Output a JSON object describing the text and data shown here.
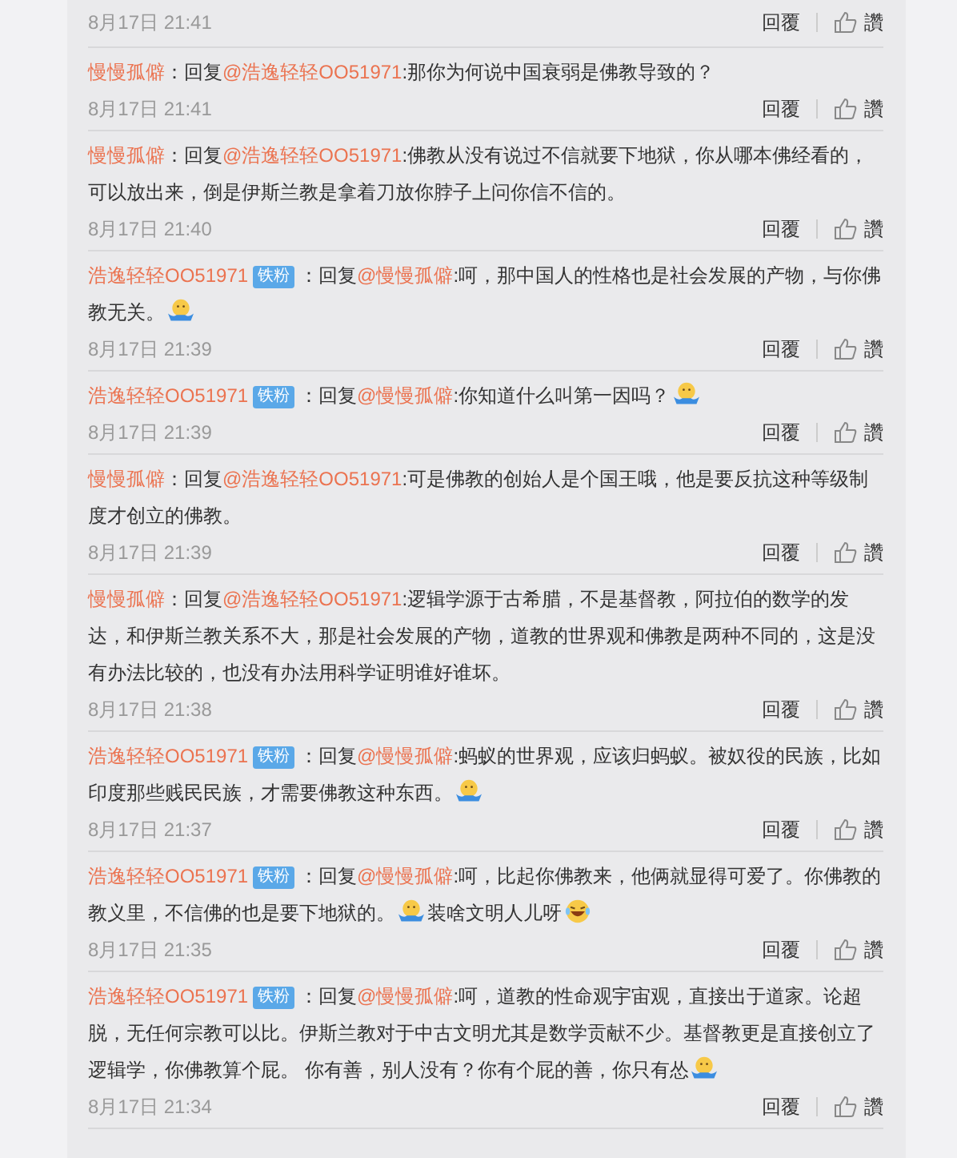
{
  "comments": [
    {
      "time": "8月17日 21:41",
      "reply": "回覆",
      "like": "讚"
    },
    {
      "user": "慢慢孤僻",
      "prefix": "：回复",
      "mention": "@浩逸轻轻OO51971",
      "body": [
        {
          "kind": "text",
          "text": ":那你为何说中国衰弱是佛教导致的？"
        }
      ],
      "time": "8月17日 21:41",
      "reply": "回覆",
      "like": "讚"
    },
    {
      "user": "慢慢孤僻",
      "prefix": "：回复",
      "mention": "@浩逸轻轻OO51971",
      "body": [
        {
          "kind": "text",
          "text": ":佛教从没有说过不信就要下地狱，你从哪本佛经看的，可以放出来，倒是伊斯兰教是拿着刀放你脖子上问你信不信的。"
        }
      ],
      "time": "8月17日 21:40",
      "reply": "回覆",
      "like": "讚"
    },
    {
      "user": "浩逸轻轻OO51971",
      "badge": "铁粉",
      "prefix": "：回复",
      "mention": "@慢慢孤僻",
      "body": [
        {
          "kind": "text",
          "text": ":呵，那中国人的性格也是社会发展的产物，与你佛教无关。"
        },
        {
          "kind": "shrug_emoji"
        }
      ],
      "time": "8月17日 21:39",
      "reply": "回覆",
      "like": "讚"
    },
    {
      "user": "浩逸轻轻OO51971",
      "badge": "铁粉",
      "prefix": "：回复",
      "mention": "@慢慢孤僻",
      "body": [
        {
          "kind": "text",
          "text": ":你知道什么叫第一因吗？"
        },
        {
          "kind": "shrug_emoji"
        }
      ],
      "time": "8月17日 21:39",
      "reply": "回覆",
      "like": "讚"
    },
    {
      "user": "慢慢孤僻",
      "prefix": "：回复",
      "mention": "@浩逸轻轻OO51971",
      "body": [
        {
          "kind": "text",
          "text": ":可是佛教的创始人是个国王哦，他是要反抗这种等级制度才创立的佛教。"
        }
      ],
      "time": "8月17日 21:39",
      "reply": "回覆",
      "like": "讚"
    },
    {
      "user": "慢慢孤僻",
      "prefix": "：回复",
      "mention": "@浩逸轻轻OO51971",
      "body": [
        {
          "kind": "text",
          "text": ":逻辑学源于古希腊，不是基督教，阿拉伯的数学的发达，和伊斯兰教关系不大，那是社会发展的产物，道教的世界观和佛教是两种不同的，这是没有办法比较的，也没有办法用科学证明谁好谁坏。"
        }
      ],
      "time": "8月17日 21:38",
      "reply": "回覆",
      "like": "讚"
    },
    {
      "user": "浩逸轻轻OO51971",
      "badge": "铁粉",
      "prefix": "：回复",
      "mention": "@慢慢孤僻",
      "body": [
        {
          "kind": "text",
          "text": ":蚂蚁的世界观，应该归蚂蚁。被奴役的民族，比如印度那些贱民民族，才需要佛教这种东西。"
        },
        {
          "kind": "shrug_emoji"
        }
      ],
      "time": "8月17日 21:37",
      "reply": "回覆",
      "like": "讚"
    },
    {
      "user": "浩逸轻轻OO51971",
      "badge": "铁粉",
      "prefix": "：回复",
      "mention": "@慢慢孤僻",
      "body": [
        {
          "kind": "text",
          "text": ":呵，比起你佛教来，他俩就显得可爱了。你佛教的教义里，不信佛的也是要下地狱的。"
        },
        {
          "kind": "shrug_emoji"
        },
        {
          "kind": "text",
          "text": "装啥文明人儿呀"
        },
        {
          "kind": "laugh_emoji"
        }
      ],
      "time": "8月17日 21:35",
      "reply": "回覆",
      "like": "讚"
    },
    {
      "user": "浩逸轻轻OO51971",
      "badge": "铁粉",
      "prefix": "：回复",
      "mention": "@慢慢孤僻",
      "body": [
        {
          "kind": "text",
          "text": ":呵，道教的性命观宇宙观，直接出于道家。论超脱，无任何宗教可以比。伊斯兰教对于中古文明尤其是数学贡献不少。基督教更是直接创立了逻辑学，你佛教算个屁。 你有善，别人没有？你有个屁的善，你只有怂"
        },
        {
          "kind": "shrug_emoji"
        }
      ],
      "time": "8月17日 21:34",
      "reply": "回覆",
      "like": "讚"
    }
  ]
}
